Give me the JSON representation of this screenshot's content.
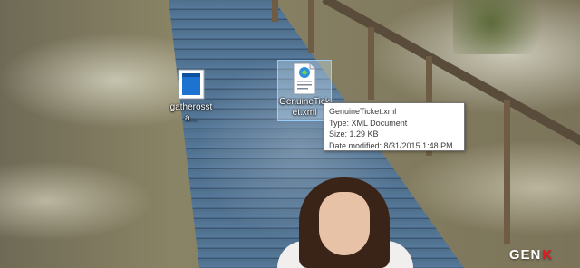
{
  "desktop": {
    "icons": [
      {
        "label": "gatherossta...",
        "icon": "generic-file-icon"
      },
      {
        "label": "GenuineTicket.xml",
        "icon": "xml-document-icon"
      }
    ]
  },
  "tooltip": {
    "name": "GenuineTicket.xml",
    "type": "Type: XML Document",
    "size": "Size: 1.29 KB",
    "modified": "Date modified: 8/31/2015 1:48 PM"
  },
  "watermark": {
    "text": "GEN",
    "mark": "K"
  },
  "colors": {
    "selection_fill": "#cde8ff",
    "selection_border": "#99d1ff",
    "tooltip_border": "#767676",
    "watermark_accent": "#e11b23"
  }
}
